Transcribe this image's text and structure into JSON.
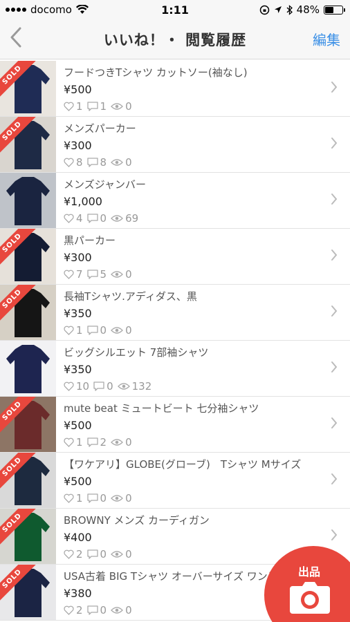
{
  "status": {
    "carrier": "docomo",
    "time": "1:11",
    "battery": "48%",
    "battery_level": 0.48
  },
  "nav": {
    "back_icon": "chevron-left-icon",
    "title": "いいね！・ 閲覧履歴",
    "edit_label": "編集"
  },
  "fab": {
    "label": "出品",
    "icon": "camera-icon"
  },
  "colors": {
    "accent": "#3a8fe6",
    "sold": "#e8473d"
  },
  "items": [
    {
      "title": "フードつきTシャツ カットソー(袖なし)",
      "price": "¥500",
      "likes": "1",
      "comments": "1",
      "views": "0",
      "sold": true,
      "sold_label": "SOLD",
      "thumb": [
        "#e9e5df",
        "#1f2c55"
      ]
    },
    {
      "title": "メンズパーカー",
      "price": "¥300",
      "likes": "8",
      "comments": "8",
      "views": "0",
      "sold": true,
      "sold_label": "SOLD",
      "thumb": [
        "#d9d5cf",
        "#1e2a45"
      ]
    },
    {
      "title": "メンズジャンバー",
      "price": "¥1,000",
      "likes": "4",
      "comments": "0",
      "views": "69",
      "sold": false,
      "sold_label": "",
      "thumb": [
        "#bfc3c9",
        "#1a2440"
      ]
    },
    {
      "title": "黒パーカー",
      "price": "¥300",
      "likes": "7",
      "comments": "5",
      "views": "0",
      "sold": true,
      "sold_label": "SOLD",
      "thumb": [
        "#e6e1da",
        "#141c33"
      ]
    },
    {
      "title": "長袖Tシャツ.アディダス、黒",
      "price": "¥350",
      "likes": "1",
      "comments": "0",
      "views": "0",
      "sold": true,
      "sold_label": "SOLD",
      "thumb": [
        "#d6d0c5",
        "#151515"
      ]
    },
    {
      "title": "ビッグシルエット 7部袖シャツ",
      "price": "¥350",
      "likes": "10",
      "comments": "0",
      "views": "132",
      "sold": false,
      "sold_label": "",
      "thumb": [
        "#f2f2f4",
        "#1e2550"
      ]
    },
    {
      "title": "mute beat ミュートビート 七分袖シャツ",
      "price": "¥500",
      "likes": "1",
      "comments": "2",
      "views": "0",
      "sold": true,
      "sold_label": "SOLD",
      "thumb": [
        "#8d7565",
        "#6b2b2b"
      ]
    },
    {
      "title": "【ワケアリ】GLOBE(グローブ)　Tシャツ Mサイズ",
      "price": "¥500",
      "likes": "1",
      "comments": "0",
      "views": "0",
      "sold": true,
      "sold_label": "SOLD",
      "thumb": [
        "#d9d9d9",
        "#1d2a3f"
      ]
    },
    {
      "title": "BROWNY メンズ  カーディガン",
      "price": "¥400",
      "likes": "2",
      "comments": "0",
      "views": "0",
      "sold": true,
      "sold_label": "SOLD",
      "thumb": [
        "#d6d6d0",
        "#0f5a2f"
      ]
    },
    {
      "title": "USA古着 BIG Tシャツ オーバーサイズ ワンピ",
      "price": "¥380",
      "likes": "2",
      "comments": "0",
      "views": "0",
      "sold": true,
      "sold_label": "SOLD",
      "thumb": [
        "#e8e8ea",
        "#1b2444"
      ]
    }
  ]
}
